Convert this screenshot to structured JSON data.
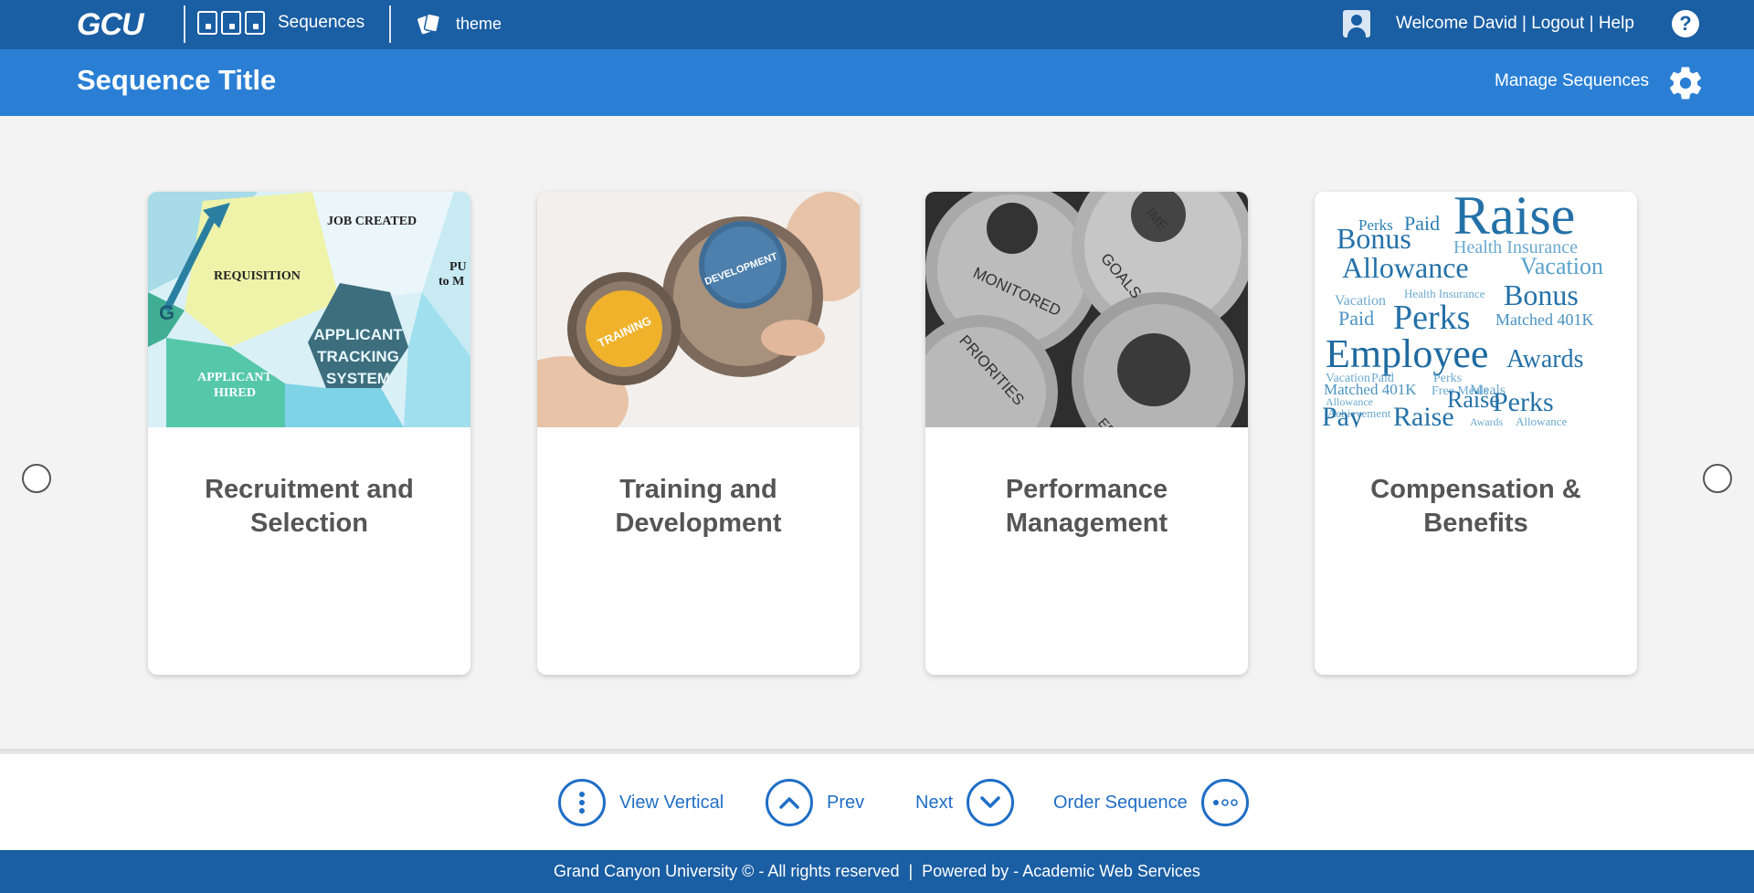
{
  "topbar": {
    "logo": "GCU",
    "sequences_label": "Sequences",
    "theme_label": "theme",
    "welcome_text": "Welcome David",
    "logout_label": "Logout",
    "help_label": "Help",
    "separator": "|"
  },
  "titlebar": {
    "title": "Sequence Title",
    "manage_label": "Manage Sequences"
  },
  "cards": [
    {
      "title": "Recruitment and Selection",
      "image": {
        "labels": [
          "JOB CREATED",
          "REQUISITION",
          "APPLICANT TRACKING SYSTEM",
          "APPLICANT HIRED",
          "G",
          "PU",
          "to M"
        ]
      }
    },
    {
      "title": "Training and Development",
      "image": {
        "labels": [
          "TRAINING",
          "DEVELOPMENT"
        ]
      }
    },
    {
      "title": "Performance Management",
      "image": {
        "labels": [
          "GOALS",
          "MONITORED",
          "PRIORITIES",
          "IME",
          "EF"
        ]
      }
    },
    {
      "title": "Compensation & Benefits",
      "image": {
        "labels": [
          "Perks",
          "Paid",
          "Raise",
          "Bonus",
          "Health Insurance",
          "Allowance",
          "Vacation",
          "Employee",
          "Awards",
          "Matched 401K",
          "Pay",
          "Free Meals",
          "Achievement"
        ]
      }
    }
  ],
  "toolbar": {
    "view_vertical": "View Vertical",
    "prev": "Prev",
    "next": "Next",
    "order_sequence": "Order Sequence"
  },
  "footer": {
    "text": "Grand Canyon University © - All rights reserved  |  Powered by - Academic Web Services"
  },
  "colors": {
    "topbar": "#1a5ea3",
    "titlebar": "#2a7fd5",
    "accent": "#1f6ec6",
    "card_title": "#555555"
  },
  "icons": [
    "user-icon",
    "help-icon",
    "gear-icon",
    "vertical-dots-icon",
    "chevron-up-icon",
    "chevron-down-icon",
    "horizontal-dots-icon"
  ]
}
